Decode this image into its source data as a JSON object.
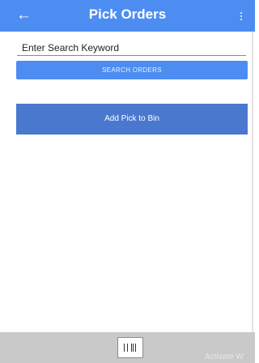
{
  "header": {
    "title": "Pick Orders",
    "back_icon": "back-arrow-icon",
    "menu_icon": "more-vert-icon",
    "background": "#4d8df2"
  },
  "search": {
    "placeholder": "Enter Search Keyword",
    "button_label": "SEARCH ORDERS"
  },
  "actions": {
    "add_pick_label": "Add Pick to Bin",
    "add_pick_color": "#4a78cf"
  },
  "footer": {
    "scanner_icon": "barcode-icon",
    "watermark": "Activate W"
  }
}
